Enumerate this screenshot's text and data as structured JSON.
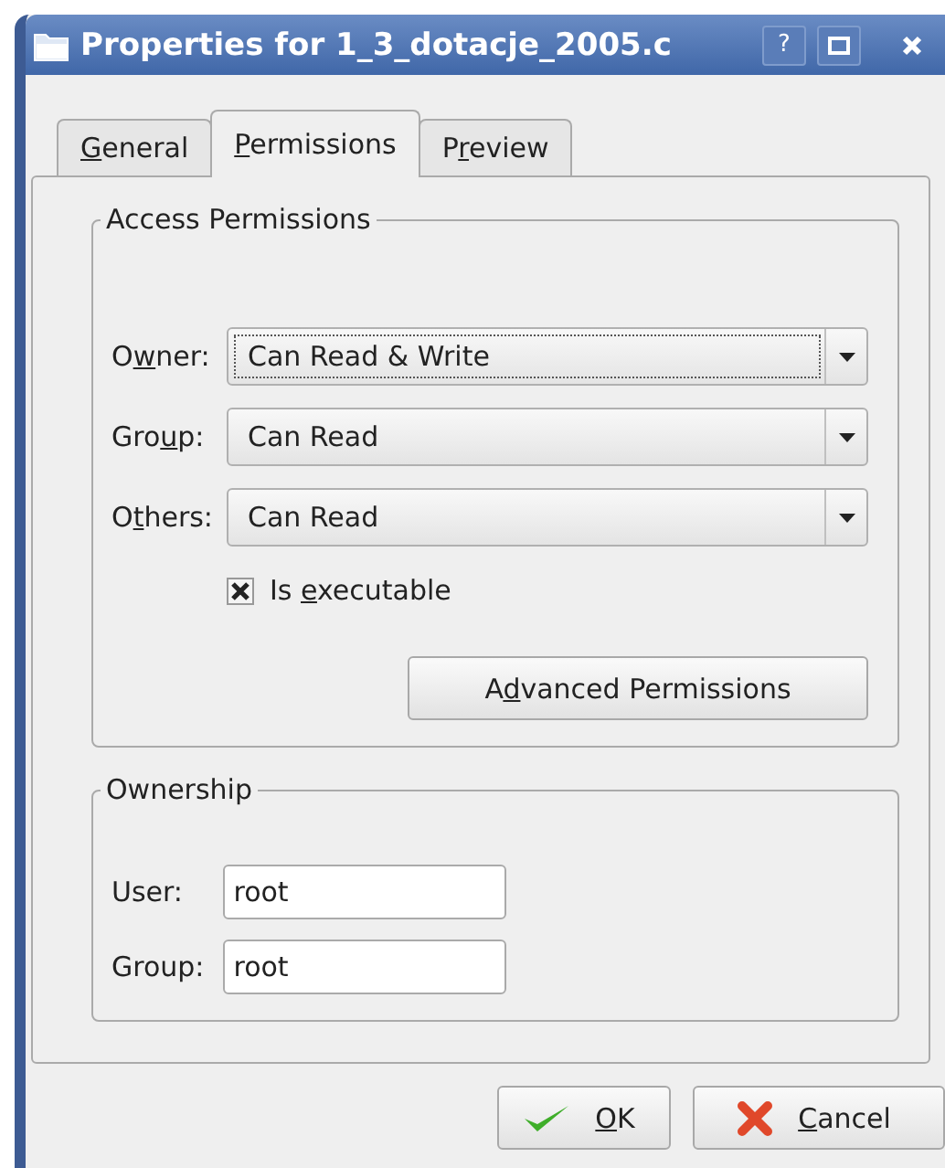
{
  "window": {
    "title": "Properties for 1_3_dotacje_2005.c",
    "buttons": [
      "?"
    ]
  },
  "tabs": [
    {
      "label": [
        {
          "text": "G",
          "underline": true
        },
        {
          "text": "eneral",
          "underline": false
        }
      ],
      "selected": false
    },
    {
      "label": [
        {
          "text": "P",
          "underline": true
        },
        {
          "text": "ermissions",
          "underline": false
        }
      ],
      "selected": true
    },
    {
      "label": [
        {
          "text": "P",
          "underline": false
        },
        {
          "text": "r",
          "underline": true
        },
        {
          "text": "eview",
          "underline": false
        }
      ],
      "selected": false
    }
  ],
  "access_permissions": {
    "title": "Access Permissions",
    "rows": [
      {
        "label": [
          {
            "text": "O",
            "underline": false
          },
          {
            "text": "w",
            "underline": true
          },
          {
            "text": "ner:",
            "underline": false
          }
        ],
        "value": "Can Read & Write",
        "focused": true
      },
      {
        "label": [
          {
            "text": "Gro",
            "underline": false
          },
          {
            "text": "u",
            "underline": true
          },
          {
            "text": "p:",
            "underline": false
          }
        ],
        "value": "Can Read",
        "focused": false
      },
      {
        "label": [
          {
            "text": "O",
            "underline": false
          },
          {
            "text": "t",
            "underline": true
          },
          {
            "text": "hers:",
            "underline": false
          }
        ],
        "value": "Can Read",
        "focused": false
      }
    ],
    "executable": {
      "label": [
        {
          "text": "Is ",
          "underline": false
        },
        {
          "text": "e",
          "underline": true
        },
        {
          "text": "xecutable",
          "underline": false
        }
      ],
      "checked": true
    },
    "advanced_button": {
      "label": [
        {
          "text": "A",
          "underline": false
        },
        {
          "text": "d",
          "underline": true
        },
        {
          "text": "vanced Permissions",
          "underline": false
        }
      ]
    }
  },
  "ownership": {
    "title": "Ownership",
    "fields": [
      {
        "label": "User:",
        "value": "root"
      },
      {
        "label": "Group:",
        "value": "root"
      }
    ]
  },
  "buttons": [
    {
      "kind": "ok",
      "label": [
        {
          "text": "O",
          "underline": true
        },
        {
          "text": "K",
          "underline": false
        }
      ]
    },
    {
      "kind": "cancel",
      "label": [
        {
          "text": "C",
          "underline": true
        },
        {
          "text": "ancel",
          "underline": false
        }
      ]
    }
  ]
}
